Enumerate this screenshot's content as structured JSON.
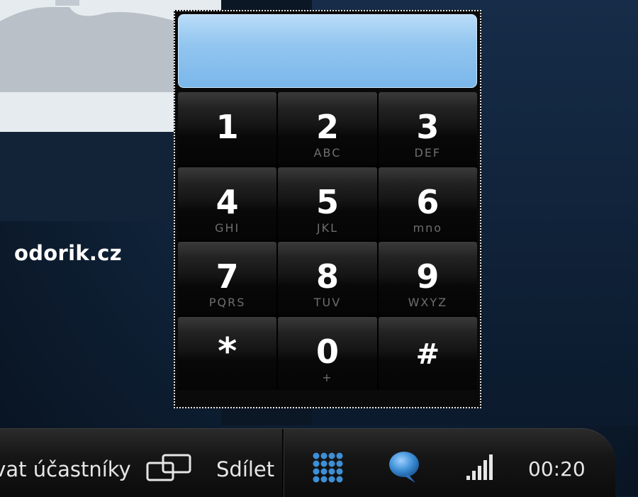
{
  "caller": {
    "name": "odorik.cz"
  },
  "dialpad": {
    "display_value": "",
    "keys": [
      {
        "digit": "1",
        "letters": ""
      },
      {
        "digit": "2",
        "letters": "ABC"
      },
      {
        "digit": "3",
        "letters": "DEF"
      },
      {
        "digit": "4",
        "letters": "GHI"
      },
      {
        "digit": "5",
        "letters": "JKL"
      },
      {
        "digit": "6",
        "letters": "mno"
      },
      {
        "digit": "7",
        "letters": "PQRS"
      },
      {
        "digit": "8",
        "letters": "TUV"
      },
      {
        "digit": "9",
        "letters": "WXYZ"
      },
      {
        "digit": "*",
        "letters": ""
      },
      {
        "digit": "0",
        "letters": "+"
      },
      {
        "digit": "#",
        "letters": ""
      }
    ]
  },
  "toolbar": {
    "add_participants_label": "zvat účastníky",
    "share_label": "Sdílet",
    "call_timer": "00:20",
    "icons": {
      "share": "screen-share-icon",
      "dialpad": "dialpad-icon",
      "chat": "chat-bubble-icon",
      "signal": "signal-strength-icon"
    }
  },
  "colors": {
    "dial_display": "#8ec3ee",
    "accent_blue": "#3d8fd6"
  }
}
